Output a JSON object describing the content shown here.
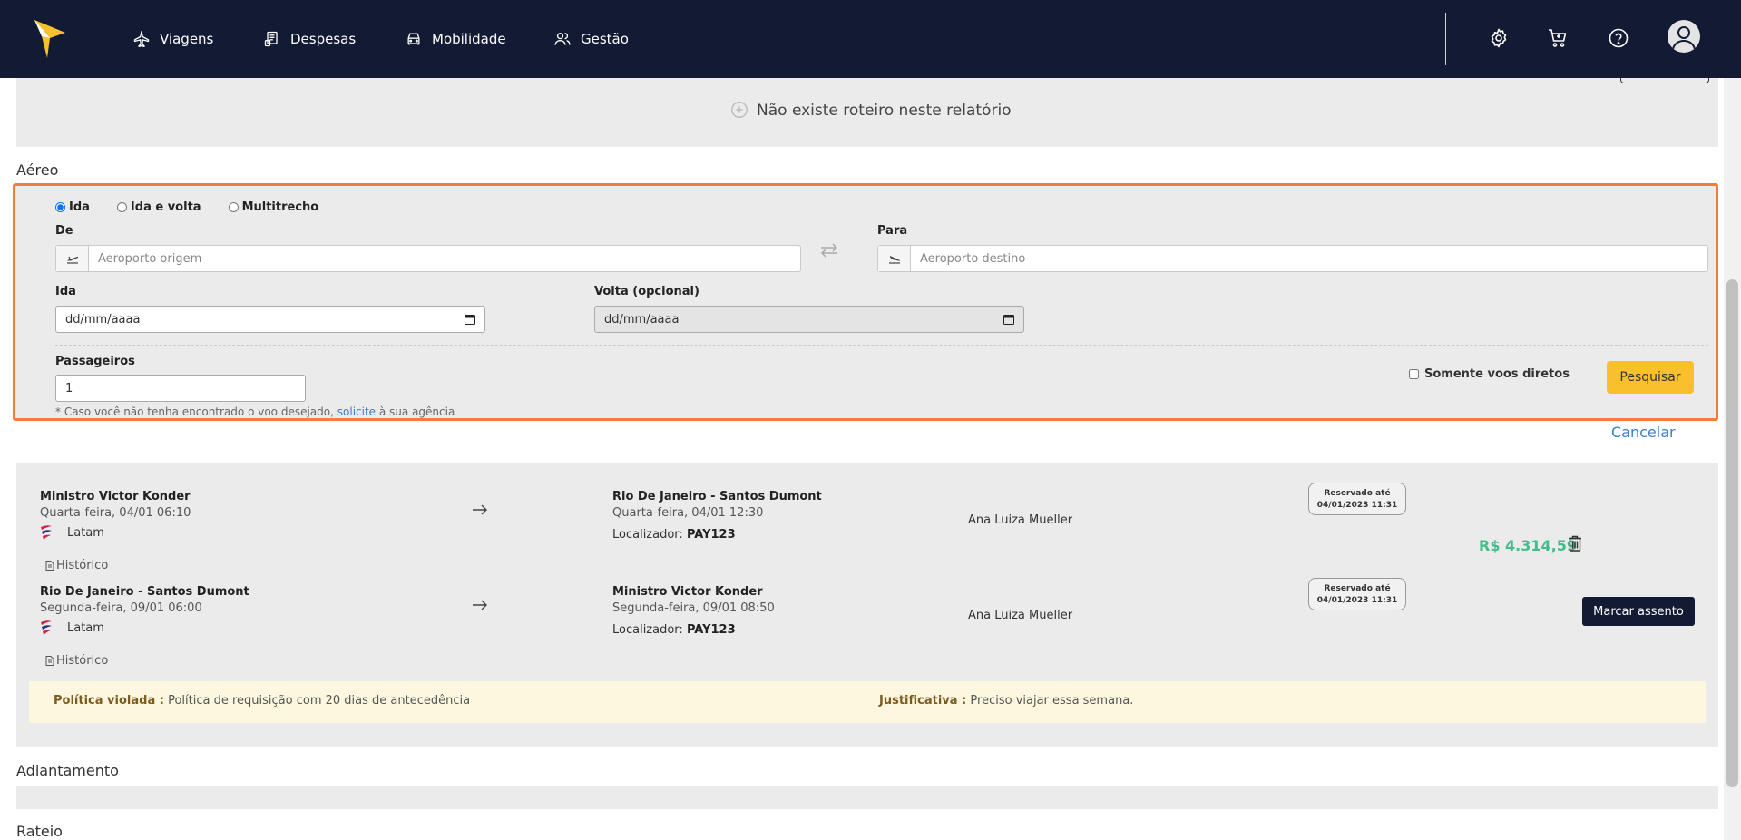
{
  "nav": {
    "items": [
      {
        "label": "Viagens",
        "icon": "airplane-icon"
      },
      {
        "label": "Despesas",
        "icon": "receipt-icon"
      },
      {
        "label": "Mobilidade",
        "icon": "car-icon"
      },
      {
        "label": "Gestão",
        "icon": "users-icon"
      }
    ],
    "right_icons": [
      "gear-icon",
      "cart-icon",
      "help-icon",
      "user-avatar-icon"
    ]
  },
  "itinerary": {
    "empty_message": "Não existe roteiro neste relatório"
  },
  "air_section": {
    "title": "Aéreo",
    "trip_types": [
      "Ida",
      "Ida e volta",
      "Multitrecho"
    ],
    "selected_trip_type": "Ida",
    "from_label": "De",
    "from_placeholder": "Aeroporto origem",
    "to_label": "Para",
    "to_placeholder": "Aeroporto destino",
    "departure_label": "Ida",
    "departure_value": "dd/mm/aaaa",
    "return_label": "Volta (opcional)",
    "return_value": "dd/mm/aaaa",
    "passengers_label": "Passageiros",
    "passengers_value": "1",
    "note_prefix": "* Caso você não tenha encontrado o voo desejado,",
    "note_link": "solicite",
    "note_suffix": "à sua agência",
    "direct_only_label": "Somente voos diretos",
    "search_button": "Pesquisar",
    "cancel_link": "Cancelar"
  },
  "flights": [
    {
      "origin": "Ministro Victor Konder",
      "origin_time": "Quarta-feira, 04/01 06:10",
      "destination": "Rio De Janeiro - Santos Dumont",
      "destination_time": "Quarta-feira, 04/01 12:30",
      "airline": "Latam",
      "locator_label": "Localizador:",
      "locator": "PAY123",
      "passenger": "Ana Luiza Mueller",
      "reserved_label": "Reservado até",
      "reserved_until": "04/01/2023 11:31",
      "history_label": "Histórico"
    },
    {
      "origin": "Rio De Janeiro - Santos Dumont",
      "origin_time": "Segunda-feira, 09/01 06:00",
      "destination": "Ministro Victor Konder",
      "destination_time": "Segunda-feira, 09/01 08:50",
      "airline": "Latam",
      "locator_label": "Localizador:",
      "locator": "PAY123",
      "passenger": "Ana Luiza Mueller",
      "reserved_label": "Reservado até",
      "reserved_until": "04/01/2023 11:31",
      "history_label": "Histórico"
    }
  ],
  "price": "R$ 4.314,59",
  "seat_button": "Marcar assento",
  "policy": {
    "violated_label": "Política violada :",
    "violated_text": "Política de requisição com 20 dias de antecedência",
    "justification_label": "Justificativa :",
    "justification_text": "Preciso viajar essa semana."
  },
  "sections": {
    "advance": "Adiantamento",
    "split": "Rateio"
  },
  "colors": {
    "navbar": "#131b34",
    "accent_yellow": "#f9c02d",
    "highlight_border": "#f47c3c",
    "price_green": "#3dbf87",
    "link_blue": "#3c7dc9"
  }
}
